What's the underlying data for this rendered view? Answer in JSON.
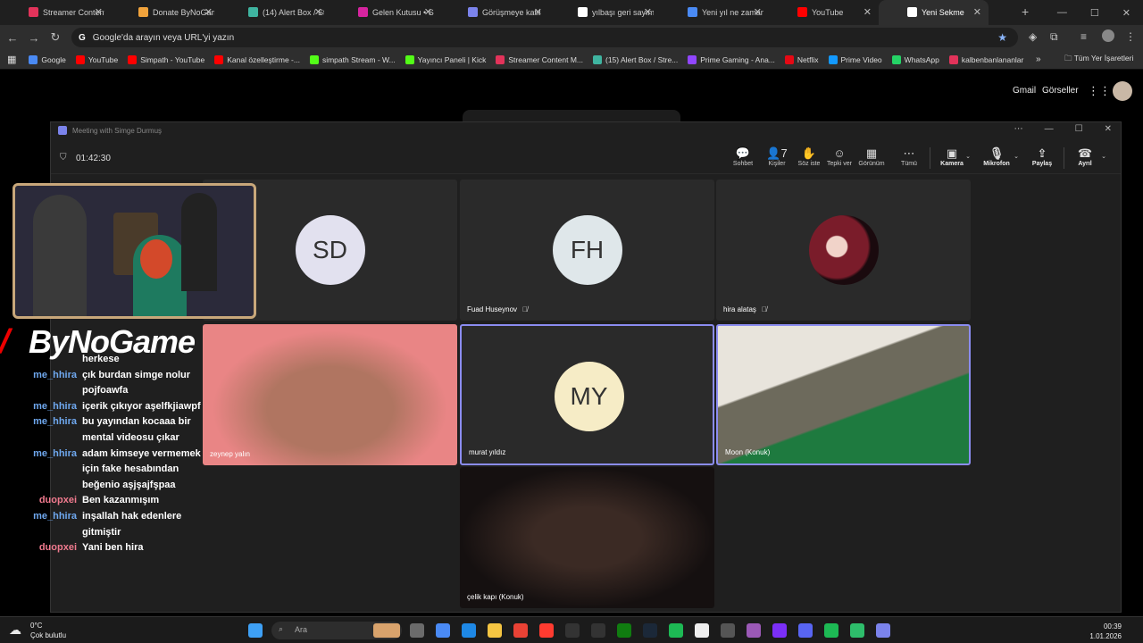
{
  "tabs": [
    {
      "label": "Streamer Content Ma",
      "color": "#e2335a"
    },
    {
      "label": "Donate ByNoGame -",
      "color": "#f1a33c"
    },
    {
      "label": "(14) Alert Box / Strea",
      "color": "#3fb4a0"
    },
    {
      "label": "Gelen Kutusu • Sohbe",
      "color": "#d6249f"
    },
    {
      "label": "Görüşmeye katıl",
      "color": "#7b83eb"
    },
    {
      "label": "yılbaşı geri sayım 20",
      "color": "#ffffff"
    },
    {
      "label": "Yeni yıl ne zaman 202",
      "color": "#4a8af4"
    },
    {
      "label": "YouTube",
      "color": "#ff0000"
    },
    {
      "label": "Yeni Sekme",
      "color": "#ffffff"
    }
  ],
  "omnibox": {
    "placeholder": "Google'da arayın veya URL'yi yazın",
    "g": "G"
  },
  "bookmarks": [
    {
      "label": "Google",
      "color": "#4a8af4"
    },
    {
      "label": "YouTube",
      "color": "#ff0000"
    },
    {
      "label": "Simpath - YouTube",
      "color": "#ff0000"
    },
    {
      "label": "Kanal özelleştirme -...",
      "color": "#ff0000"
    },
    {
      "label": "simpath Stream - W...",
      "color": "#53fc18"
    },
    {
      "label": "Yayıncı Paneli | Kick",
      "color": "#53fc18"
    },
    {
      "label": "Streamer Content M...",
      "color": "#e2335a"
    },
    {
      "label": "(15) Alert Box / Stre...",
      "color": "#3fb4a0"
    },
    {
      "label": "Prime Gaming - Ana...",
      "color": "#9146ff"
    },
    {
      "label": "Netflix",
      "color": "#e50914"
    },
    {
      "label": "Prime Video",
      "color": "#1399ff"
    },
    {
      "label": "WhatsApp",
      "color": "#25d366"
    },
    {
      "label": "kalbenbanlananlar",
      "color": "#e2335a"
    }
  ],
  "bookmarks_all": "Tüm Yer İşaretleri",
  "google_links": {
    "gmail": "Gmail",
    "images": "Görseller"
  },
  "meeting": {
    "title": "Meeting with Simge Durmuş",
    "timer": "01:42:30",
    "toolbar": [
      {
        "icon": "chat-icon",
        "glyph": "💬",
        "label": "Sohbet"
      },
      {
        "icon": "people-icon",
        "glyph": "👤7",
        "label": "Kişiler"
      },
      {
        "icon": "raise-hand-icon",
        "glyph": "✋",
        "label": "Söz iste"
      },
      {
        "icon": "react-icon",
        "glyph": "☺",
        "label": "Tepki ver"
      },
      {
        "icon": "view-icon",
        "glyph": "▦",
        "label": "Görünüm"
      },
      {
        "icon": "more-icon",
        "glyph": "⋯",
        "label": "Tümü"
      }
    ],
    "camera": "Kamera",
    "mic": "Mikrofon",
    "share": "Paylaş",
    "leave": "Ayrıl",
    "participants": [
      {
        "initials": "SD",
        "name": "",
        "color": "#e2e1ef"
      },
      {
        "initials": "FH",
        "name": "Fuad Huseynov",
        "color": "#dfe7ea"
      },
      {
        "initials": "",
        "name": "hira alataş",
        "color": "#7a1c2a"
      },
      {
        "initials": "",
        "name": "zeynep yalın",
        "color": "#e98585"
      },
      {
        "initials": "MY",
        "name": "murat yıldız",
        "color": "#f6ecc6"
      },
      {
        "initials": "",
        "name": "Moon (Konuk)",
        "color": "#6d6a5c"
      },
      {
        "initials": "",
        "name": "çelik kapı (Konuk)",
        "color": "#2a1d1a"
      }
    ]
  },
  "overlay": {
    "logo": "ByNoGame",
    "chat": [
      {
        "user": "",
        "msg": "herkese",
        "c": "blue"
      },
      {
        "user": "me_hhira",
        "msg": "çık burdan simge nolur",
        "c": "blue"
      },
      {
        "user": "",
        "msg": "pojfoawfa",
        "c": "blue"
      },
      {
        "user": "me_hhira",
        "msg": "içerik çıkıyor aşelfkjiawpf",
        "c": "blue"
      },
      {
        "user": "me_hhira",
        "msg": "bu yayından kocaaa bir",
        "c": "blue"
      },
      {
        "user": "",
        "msg": "mental videosu çıkar",
        "c": "blue"
      },
      {
        "user": "me_hhira",
        "msg": "adam kimseye vermemek",
        "c": "blue"
      },
      {
        "user": "",
        "msg": "için fake hesabından",
        "c": "blue"
      },
      {
        "user": "",
        "msg": "beğenio aşjşajfşpaa",
        "c": "blue"
      },
      {
        "user": "duopxei",
        "msg": "Ben kazanmışım",
        "c": "pink"
      },
      {
        "user": "me_hhira",
        "msg": "inşallah hak edenlere",
        "c": "blue"
      },
      {
        "user": "",
        "msg": "gitmiştir",
        "c": "blue"
      },
      {
        "user": "duopxei",
        "msg": "Yani ben hira",
        "c": "pink"
      }
    ]
  },
  "taskbar": {
    "temp": "0°C",
    "weather": "Çok bulutlu",
    "search": "Ara",
    "time": "00:39",
    "date": "1.01.2026"
  }
}
